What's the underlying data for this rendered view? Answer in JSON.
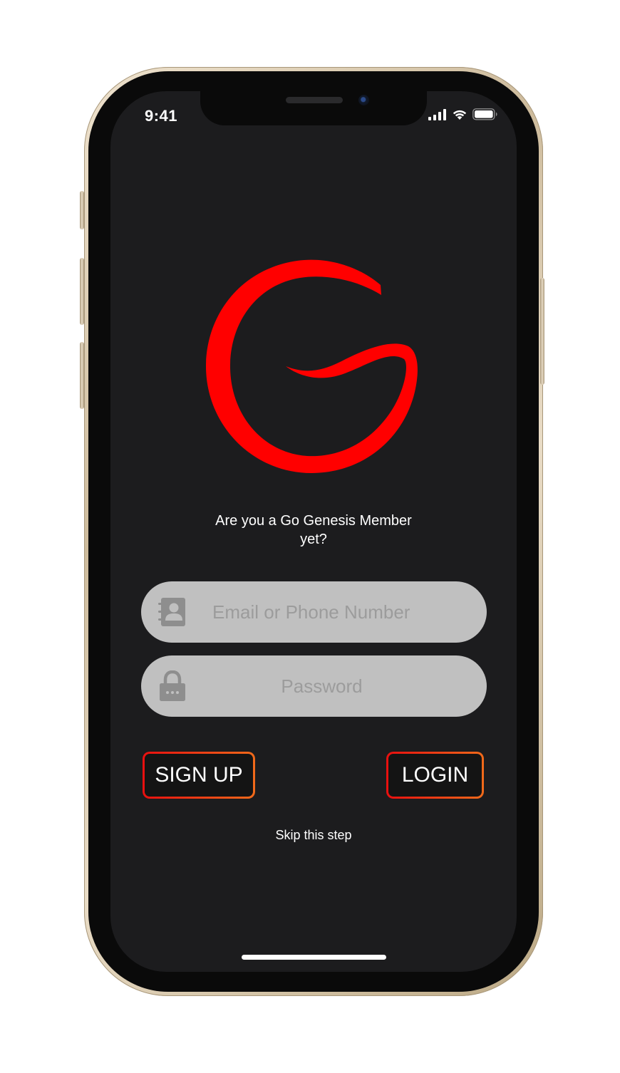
{
  "status_bar": {
    "time": "9:41",
    "icons": [
      "cellular-signal-icon",
      "wifi-icon",
      "battery-icon"
    ]
  },
  "logo": {
    "icon": "go-genesis-logo",
    "color": "#ff0000"
  },
  "prompt": {
    "line1": "Are you a Go Genesis Member",
    "line2": "yet?"
  },
  "email_field": {
    "icon": "contact-book-icon",
    "placeholder": "Email or Phone Number",
    "value": ""
  },
  "password_field": {
    "icon": "lock-icon",
    "placeholder": "Password",
    "value": ""
  },
  "buttons": {
    "signup_label": "SIGN UP",
    "login_label": "LOGIN"
  },
  "skip_link": "Skip this step",
  "colors": {
    "screen_background": "#1c1c1e",
    "accent_red": "#ff0000",
    "button_border_start": "#e80f0f",
    "button_border_end": "#f06a1a",
    "field_background": "#c0c0c0"
  }
}
